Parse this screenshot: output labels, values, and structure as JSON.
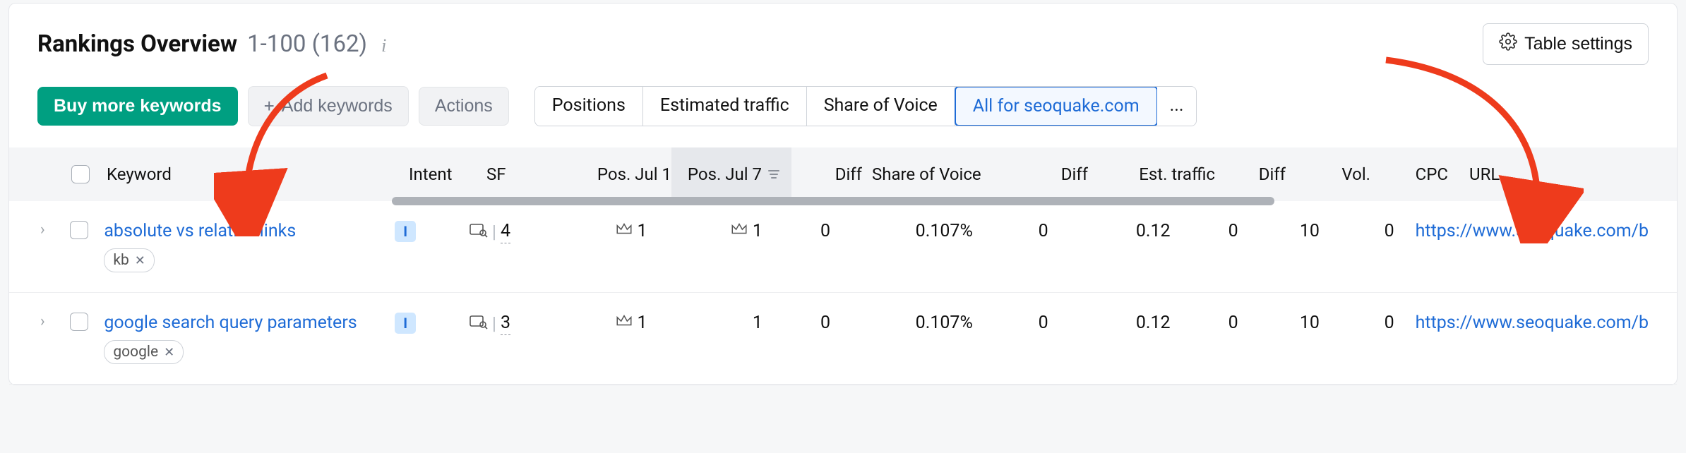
{
  "header": {
    "title": "Rankings Overview",
    "range": "1-100",
    "total": "(162)"
  },
  "table_settings_label": "Table settings",
  "toolbar": {
    "buy_label": "Buy more keywords",
    "add_label": "Add keywords",
    "actions_label": "Actions",
    "tabs": {
      "positions": "Positions",
      "est_traffic": "Estimated traffic",
      "sov": "Share of Voice",
      "all_for": "All for seoquake.com",
      "more": "..."
    }
  },
  "columns": {
    "keyword": "Keyword",
    "intent": "Intent",
    "sf": "SF",
    "pos1": "Pos. Jul 1",
    "pos2": "Pos. Jul 7",
    "diff": "Diff",
    "sov": "Share of Voice",
    "est": "Est. traffic",
    "vol": "Vol.",
    "cpc": "CPC",
    "url": "URL"
  },
  "rows": [
    {
      "keyword": "absolute vs relative links",
      "tag": "kb",
      "intent": "I",
      "sf": "4",
      "pos1": "1",
      "pos1_crown": true,
      "pos2": "1",
      "pos2_crown": true,
      "diff1": "0",
      "sov": "0.107%",
      "diff2": "0",
      "est": "0.12",
      "diff3": "0",
      "vol": "10",
      "cpc": "0",
      "url": "https://www.seoquake.com/b"
    },
    {
      "keyword": "google search query parameters",
      "tag": "google",
      "intent": "I",
      "sf": "3",
      "pos1": "1",
      "pos1_crown": true,
      "pos2": "1",
      "pos2_crown": false,
      "diff1": "0",
      "sov": "0.107%",
      "diff2": "0",
      "est": "0.12",
      "diff3": "0",
      "vol": "10",
      "cpc": "0",
      "url": "https://www.seoquake.com/b"
    }
  ]
}
